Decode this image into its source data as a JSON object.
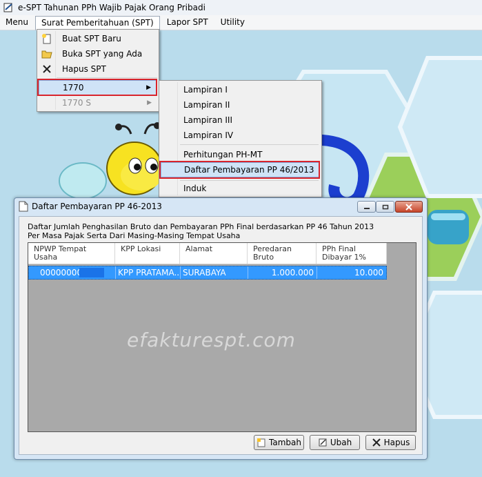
{
  "window": {
    "title": "e-SPT Tahunan PPh Wajib Pajak Orang Pribadi"
  },
  "menubar": {
    "items": [
      "Menu",
      "Surat Pemberitahuan (SPT)",
      "Lapor SPT",
      "Utility"
    ]
  },
  "dropdown": {
    "items": [
      {
        "label": "Buat SPT Baru",
        "icon": "new-document-icon"
      },
      {
        "label": "Buka SPT yang Ada",
        "icon": "open-folder-icon"
      },
      {
        "label": "Hapus SPT",
        "icon": "delete-x-icon"
      },
      {
        "label": "1770",
        "icon": "chevron-right-icon"
      },
      {
        "label": "1770 S",
        "icon": "chevron-right-icon"
      }
    ]
  },
  "submenu": {
    "items": [
      "Lampiran I",
      "Lampiran II",
      "Lampiran III",
      "Lampiran IV",
      "Perhitungan PH-MT",
      "Daftar Pembayaran PP 46/2013",
      "Induk"
    ]
  },
  "dialog": {
    "title": "Daftar Pembayaran PP 46-2013",
    "description_line1": "Daftar Jumlah Penghasilan Bruto dan Pembayaran PPh Final berdasarkan PP 46 Tahun 2013",
    "description_line2": "Per Masa Pajak Serta Dari Masing-Masing Tempat Usaha",
    "columns": [
      {
        "line1": "NPWP Tempat",
        "line2": "Usaha"
      },
      {
        "line1": "KPP Lokasi",
        "line2": ""
      },
      {
        "line1": "Alamat",
        "line2": ""
      },
      {
        "line1": "Peredaran",
        "line2": "Bruto"
      },
      {
        "line1": "PPh Final",
        "line2": "Dibayar 1%"
      }
    ],
    "rows": [
      {
        "npwp": "000000000",
        "kpp": "KPP PRATAMA...",
        "alamat": "SURABAYA",
        "bruto": "1.000.000",
        "pph": "10.000"
      }
    ],
    "buttons": {
      "tambah": "Tambah",
      "ubah": "Ubah",
      "hapus": "Hapus"
    }
  },
  "watermark": "efakturespt.com",
  "colors": {
    "selection": "#3399ff",
    "highlight_border": "#d9242c",
    "menu_highlight": "#cfe3f7"
  }
}
